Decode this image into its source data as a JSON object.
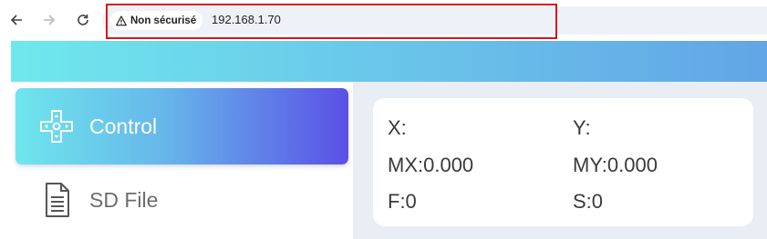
{
  "browser": {
    "security_label": "Non sécurisé",
    "url": "192.168.1.70",
    "icons": {
      "back": "arrow-left-icon",
      "forward": "arrow-right-icon",
      "reload": "reload-icon",
      "warning": "warning-triangle-icon"
    },
    "highlight_color": "#d8141c"
  },
  "sidebar": {
    "items": [
      {
        "label": "Control",
        "icon": "dpad-icon",
        "active": true
      },
      {
        "label": "SD File",
        "icon": "file-icon",
        "active": false
      }
    ]
  },
  "status": {
    "x": "X:",
    "y": "Y:",
    "mx": "MX:0.000",
    "my": "MY:0.000",
    "f": "F:0",
    "s": "S:0"
  },
  "colors": {
    "header_gradient": [
      "#6fe8ec",
      "#62a5e6"
    ],
    "active_gradient": [
      "#6ee6ec",
      "#5a50e6"
    ],
    "main_background": "#e9edf4"
  }
}
